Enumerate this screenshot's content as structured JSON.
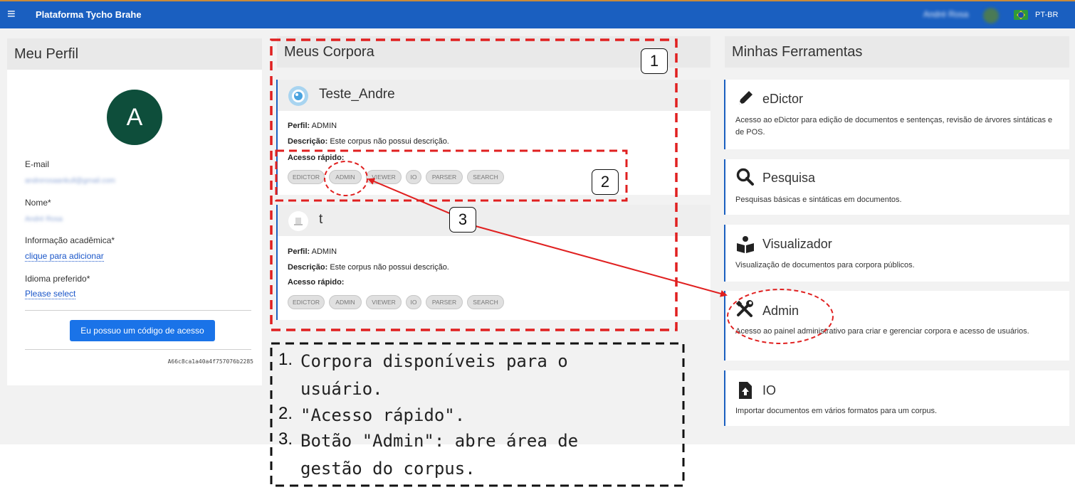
{
  "topbar": {
    "menu_glyph": "≡",
    "brand": "Plataforma Tycho Brahe",
    "user_name": "André Rosa",
    "language": "PT-BR"
  },
  "profile": {
    "heading": "Meu Perfil",
    "avatar_letter": "A",
    "email_label": "E-mail",
    "email_value": "andrerosaankull@gmail.com",
    "name_label": "Nome*",
    "name_value": "André Rosa",
    "academic_label": "Informação acadêmica*",
    "academic_value": "clique para adicionar",
    "language_label": "Idioma preferido*",
    "language_value": "Please select",
    "access_button": "Eu possuo um código de acesso",
    "code": "A66c8ca1a40a4f757076b2285"
  },
  "corpora": {
    "heading": "Meus Corpora",
    "items": [
      {
        "name": "Teste_Andre",
        "profile_label": "Perfil:",
        "profile_value": "ADMIN",
        "desc_label": "Descrição:",
        "desc_value": "Este corpus não possui descrição.",
        "quick_label": "Acesso rápido:",
        "chips": [
          "EDICTOR",
          "ADMIN",
          "VIEWER",
          "IO",
          "PARSER",
          "SEARCH"
        ]
      },
      {
        "name": "t",
        "profile_label": "Perfil:",
        "profile_value": "ADMIN",
        "desc_label": "Descrição:",
        "desc_value": "Este corpus não possui descrição.",
        "quick_label": "Acesso rápido:",
        "chips": [
          "EDICTOR",
          "ADMIN",
          "VIEWER",
          "IO",
          "PARSER",
          "SEARCH"
        ]
      }
    ]
  },
  "tools": {
    "heading": "Minhas Ferramentas",
    "items": [
      {
        "name": "eDictor",
        "icon": "pen-icon",
        "description": "Acesso ao eDictor para edição de documentos e sentenças, revisão de árvores sintáticas e de POS."
      },
      {
        "name": "Pesquisa",
        "icon": "search-icon",
        "description": "Pesquisas básicas e sintáticas em documentos."
      },
      {
        "name": "Visualizador",
        "icon": "reader-icon",
        "description": "Visualização de documentos para corpora públicos."
      },
      {
        "name": "Admin",
        "icon": "tools-icon",
        "description": "Acesso ao painel administrativo para criar e gerenciar corpora e acesso de usuários."
      },
      {
        "name": "IO",
        "icon": "file-upload-icon",
        "description": "Importar documentos em vários formatos para um corpus."
      }
    ]
  },
  "annotations": {
    "badges": [
      "1",
      "2",
      "3"
    ],
    "legend": [
      {
        "num": "1.",
        "line1": "Corpora disponíveis para o",
        "line2": "usuário."
      },
      {
        "num": "2.",
        "line1": "\"Acesso rápido\".",
        "line2": ""
      },
      {
        "num": "3.",
        "line1": "Botão \"Admin\": abre área de",
        "line2": "gestão do corpus."
      }
    ],
    "colors": {
      "red": "#e02020",
      "black": "#111111"
    }
  }
}
